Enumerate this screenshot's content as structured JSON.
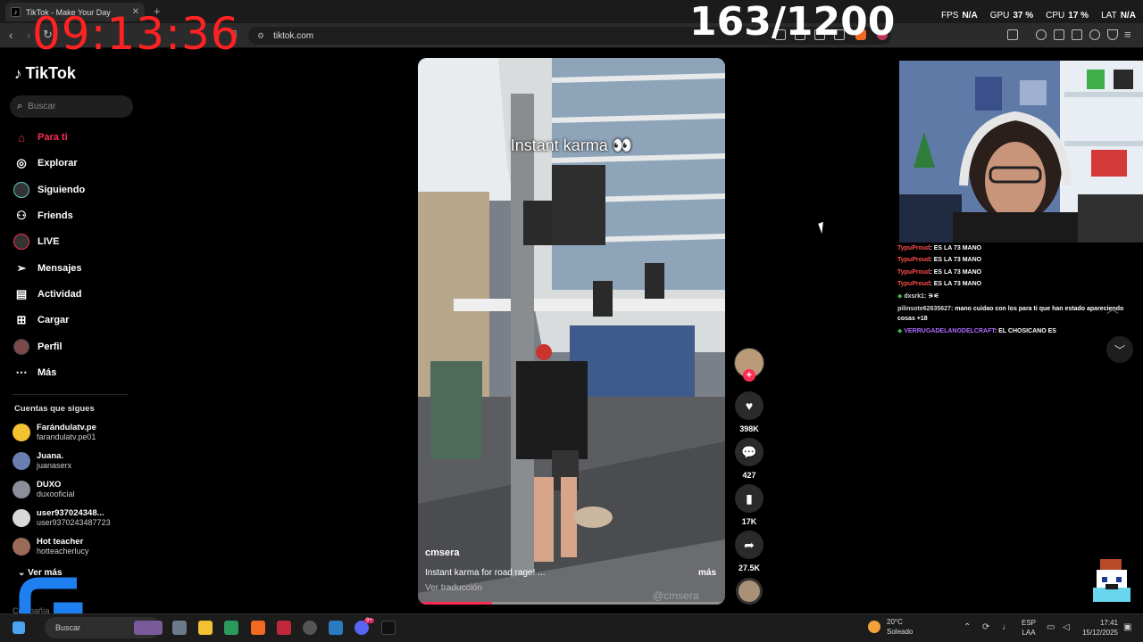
{
  "browser": {
    "tab_title": "TikTok - Make Your Day",
    "tab_close": "✕",
    "new_tab": "+",
    "url": "tiktok.com"
  },
  "overlay": {
    "clock": "09:13:36",
    "counter": "163/1200",
    "fps_label": "FPS",
    "fps_value": "N/A",
    "gpu_label": "GPU",
    "gpu_value": "37 %",
    "cpu_label": "CPU",
    "cpu_value": "17 %",
    "lat_label": "LAT",
    "lat_value": "N/A"
  },
  "sidebar": {
    "logo": "TikTok",
    "search_placeholder": "Buscar",
    "items": [
      {
        "label": "Para ti",
        "icon": "home-icon"
      },
      {
        "label": "Explorar",
        "icon": "compass-icon"
      },
      {
        "label": "Siguiendo",
        "icon": "following-avatar-icon"
      },
      {
        "label": "Friends",
        "icon": "friends-icon"
      },
      {
        "label": "LIVE",
        "icon": "live-avatar-icon"
      },
      {
        "label": "Mensajes",
        "icon": "send-icon"
      },
      {
        "label": "Actividad",
        "icon": "activity-icon"
      },
      {
        "label": "Cargar",
        "icon": "upload-icon"
      },
      {
        "label": "Perfil",
        "icon": "profile-avatar-icon"
      },
      {
        "label": "Más",
        "icon": "more-icon"
      }
    ],
    "following_header": "Cuentas que sigues",
    "following": [
      {
        "name": "Farándulatv.pe",
        "handle": "farandulatv.pe01",
        "color": "#f2c230"
      },
      {
        "name": "Juana.",
        "handle": "juanaserx",
        "color": "#6a7fb0"
      },
      {
        "name": "DUXO",
        "handle": "duxooficial",
        "color": "#8a8f9a"
      },
      {
        "name": "user937024348...",
        "handle": "user9370243487723",
        "color": "#d8d8d8"
      },
      {
        "name": "Hot teacher",
        "handle": "hotteacherlucy",
        "color": "#9b6b5a"
      }
    ],
    "see_more": "Ver más",
    "company": "Compañía"
  },
  "video": {
    "caption": "Instant karma 👀",
    "username": "cmsera",
    "description": "Instant karma for road rage! ...",
    "more": "más",
    "translate": "Ver traducción",
    "watermark": "@cmsera",
    "progress": 0.24
  },
  "actions": {
    "likes": "398K",
    "comments": "427",
    "saves": "17K",
    "shares": "27.5K"
  },
  "chat": [
    {
      "user": "TypuProud",
      "text": ": ES LA 73 MANO",
      "color": "#ff4d4d"
    },
    {
      "user": "TypuProud",
      "text": ": ES LA 73 MANO",
      "color": "#ff4d4d"
    },
    {
      "user": "TypuProud",
      "text": ": ES LA 73 MANO",
      "color": "#ff4d4d"
    },
    {
      "user": "TypuProud",
      "text": ": ES LA 73 MANO",
      "color": "#ff4d4d"
    },
    {
      "user": "dxsrk1",
      "text": ": ⚞⚟",
      "color": "#dddddd"
    },
    {
      "user": "pilinsote62635627",
      "text": ": mano cuidao con los para ti que han estado apareciendo cosas +18",
      "color": "#dddddd"
    },
    {
      "user": "VERRUGADELANODELCRAFT",
      "text": ": EL CHOSICANO ES",
      "color": "#b06cff"
    }
  ],
  "taskbar": {
    "search": "Buscar",
    "temp": "20°C",
    "weather": "Soleado",
    "lang1": "ESP",
    "lang2": "LAA",
    "time": "17:41",
    "date": "15/12/2025",
    "notif_badge": "9+"
  },
  "colors": {
    "accent": "#fe2c55",
    "clock": "#ff2222"
  }
}
